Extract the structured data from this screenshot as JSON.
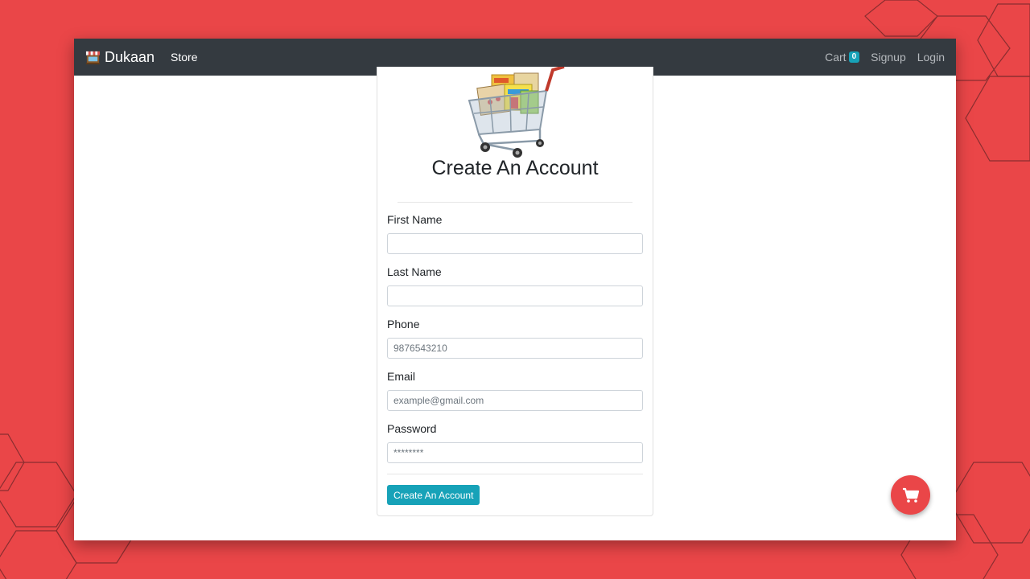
{
  "navbar": {
    "brand": "Dukaan",
    "store_label": "Store",
    "cart_label": "Cart",
    "cart_count": "0",
    "signup_label": "Signup",
    "login_label": "Login"
  },
  "form": {
    "title": "Create An Account",
    "first_name": {
      "label": "First Name",
      "value": "",
      "placeholder": ""
    },
    "last_name": {
      "label": "Last Name",
      "value": "",
      "placeholder": ""
    },
    "phone": {
      "label": "Phone",
      "value": "",
      "placeholder": "9876543210"
    },
    "email": {
      "label": "Email",
      "value": "",
      "placeholder": "example@gmail.com"
    },
    "password": {
      "label": "Password",
      "value": "",
      "placeholder": "********"
    },
    "submit_label": "Create An Account"
  },
  "icons": {
    "brand": "store-icon",
    "hero": "shopping-cart-illustration",
    "fab": "shopping-cart-icon"
  },
  "colors": {
    "background": "#ea4648",
    "navbar": "#343a40",
    "accent": "#17a2b8",
    "fab": "#ea4648"
  }
}
